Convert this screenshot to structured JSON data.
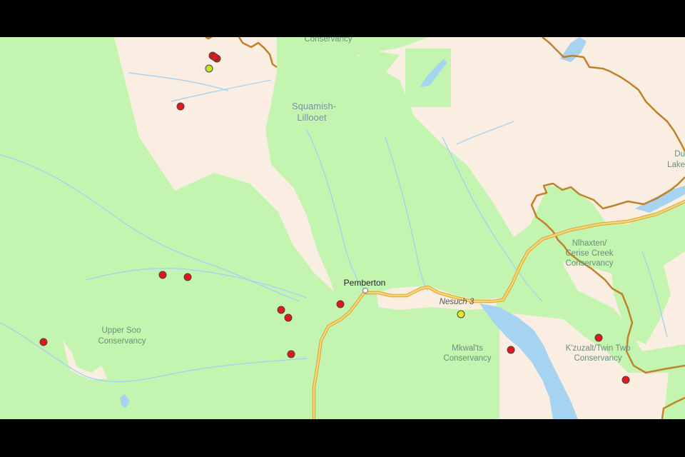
{
  "map": {
    "colors": {
      "park": "#c3f5b0",
      "land": "#faeee3",
      "water": "#a6d3f0",
      "border": "#c0822a",
      "highway": "#f2c34f",
      "marker_red": "#e4171b",
      "marker_yellow": "#e4e62b",
      "marker_lime": "#c4e52a"
    },
    "labels": {
      "conservancy_top": "Conservancy",
      "squamish_1": "Squamish-",
      "squamish_2": "Lillooet",
      "pemberton": "Pemberton",
      "nesuch": "Nesuch 3",
      "upper_soo_1": "Upper Soo",
      "upper_soo_2": "Conservancy",
      "mkwalts_1": "Mkwal'ts",
      "mkwalts_2": "Conservancy",
      "nlhaxten_1": "Nlhaxten/",
      "nlhaxten_2": "Cerise Creek",
      "nlhaxten_3": "Conservancy",
      "kzuzalt_1": "K'zuzalt/Twin Two",
      "kzuzalt_2": "Conservancy",
      "duffey_1": "Du",
      "duffey_2": "Lake"
    },
    "markers": [
      {
        "id": "m1",
        "color": "red"
      },
      {
        "id": "m2",
        "color": "red"
      },
      {
        "id": "m3",
        "color": "red"
      },
      {
        "id": "m4",
        "color": "lime"
      },
      {
        "id": "m5",
        "color": "red"
      },
      {
        "id": "m6",
        "color": "red"
      },
      {
        "id": "m7",
        "color": "red"
      },
      {
        "id": "m8",
        "color": "red"
      },
      {
        "id": "m9",
        "color": "red"
      },
      {
        "id": "m10",
        "color": "red"
      },
      {
        "id": "m11",
        "color": "red"
      },
      {
        "id": "m12",
        "color": "red"
      },
      {
        "id": "m13",
        "color": "yellow"
      },
      {
        "id": "m14",
        "color": "red"
      },
      {
        "id": "m15",
        "color": "red"
      },
      {
        "id": "m16",
        "color": "red"
      }
    ]
  }
}
